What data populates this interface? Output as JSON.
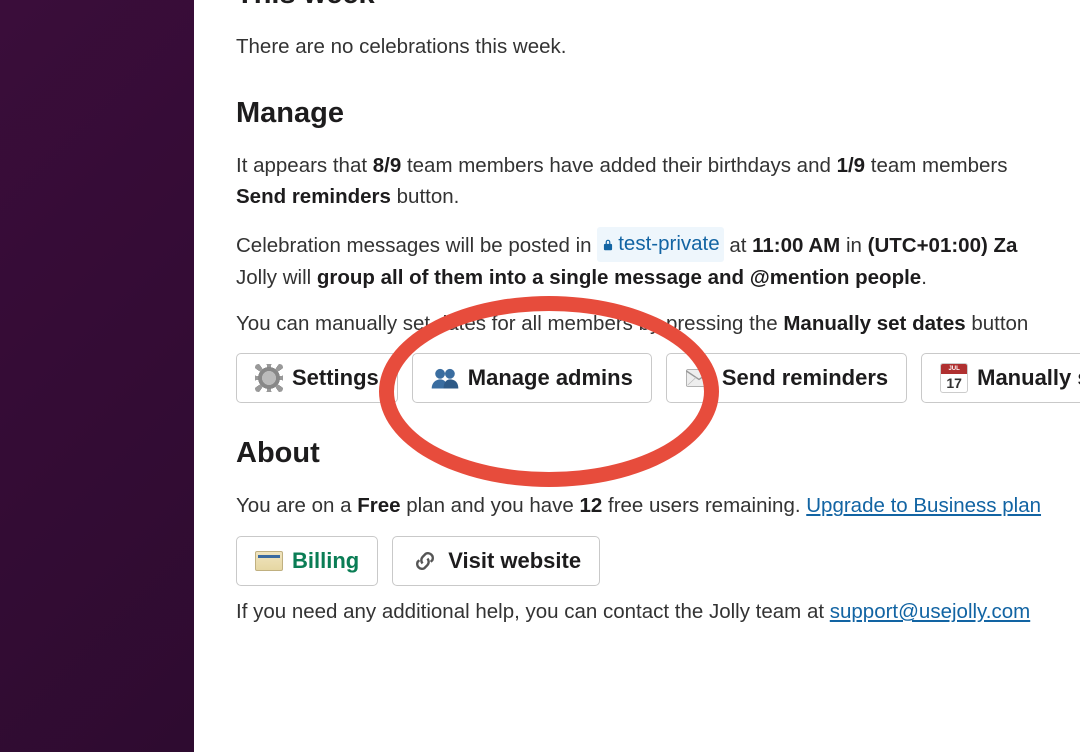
{
  "thisweek": {
    "heading": "This week",
    "empty_text": "There are no celebrations this week."
  },
  "manage": {
    "heading": "Manage",
    "line1_a": "It appears that ",
    "line1_b": "8/9",
    "line1_c": " team members have added their birthdays and ",
    "line1_d": "1/9",
    "line1_e": " team members",
    "line1_f": "Send reminders",
    "line1_g": " button.",
    "line2_a": "Celebration messages will be posted in ",
    "line2_channel": "test-private",
    "line2_b": " at ",
    "line2_time": "11:00 AM",
    "line2_c": " in ",
    "line2_tz": "(UTC+01:00) Za",
    "line2_d": "Jolly will ",
    "line2_e": "group all of them into a single message and @mention people",
    "line2_f": ".",
    "line3_a": "You can manually set dates for all members by pressing the ",
    "line3_b": "Manually set dates",
    "line3_c": " button",
    "buttons": {
      "settings": "Settings",
      "manage_admins": "Manage admins",
      "send_reminders": "Send reminders",
      "manually_set_dates": "Manually set dates"
    },
    "calendar_month": "JUL",
    "calendar_day": "17"
  },
  "about": {
    "heading": "About",
    "line1_a": "You are on a ",
    "line1_b": "Free",
    "line1_c": " plan and you have ",
    "line1_d": "12",
    "line1_e": " free users remaining. ",
    "upgrade_link": "Upgrade to Business plan",
    "buttons": {
      "billing": "Billing",
      "visit_website": "Visit website"
    },
    "line2_a": "If you need any additional help, you can contact the Jolly team at ",
    "support_email": "support@usejolly.com"
  }
}
